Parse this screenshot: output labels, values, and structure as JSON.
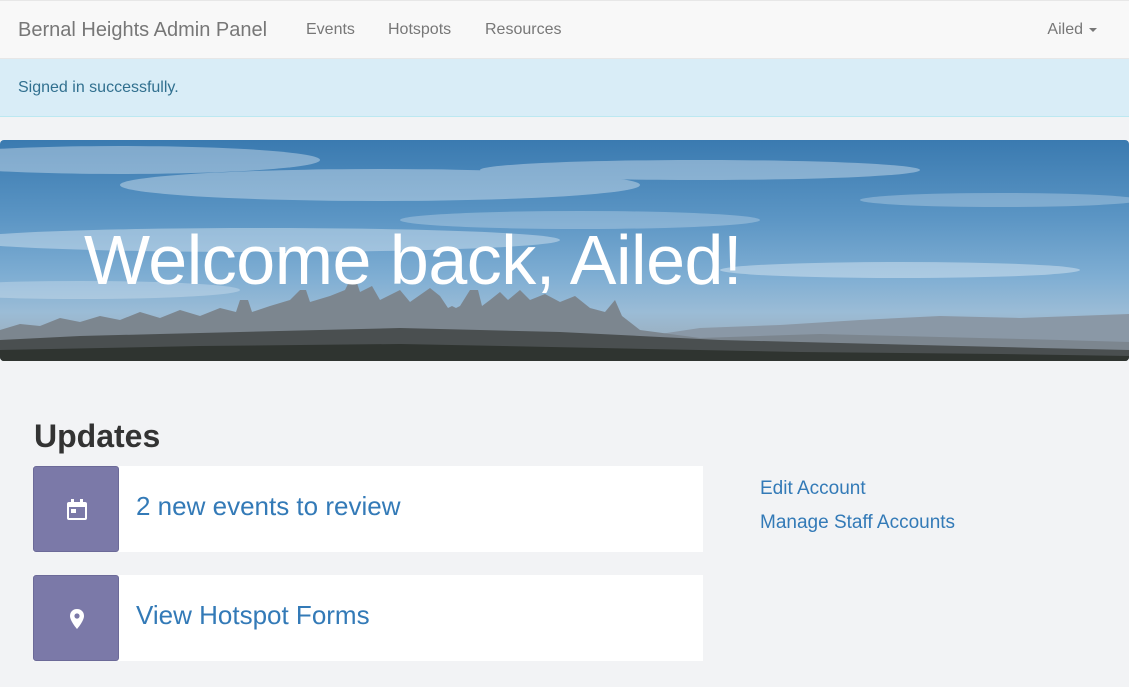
{
  "navbar": {
    "brand": "Bernal Heights Admin Panel",
    "links": [
      {
        "label": "Events"
      },
      {
        "label": "Hotspots"
      },
      {
        "label": "Resources"
      }
    ],
    "user_menu": "Ailed"
  },
  "alert": {
    "message": "Signed in successfully."
  },
  "hero": {
    "title": "Welcome back, Ailed!"
  },
  "updates": {
    "title": "Updates",
    "cards": [
      {
        "label": "2 new events to review",
        "icon": "calendar-icon"
      },
      {
        "label": "View Hotspot Forms",
        "icon": "map-pin-icon"
      }
    ]
  },
  "sidebar": {
    "links": [
      {
        "label": "Edit Account"
      },
      {
        "label": "Manage Staff Accounts"
      }
    ]
  },
  "colors": {
    "navbar_bg": "#f8f8f8",
    "alert_bg": "#d9edf7",
    "alert_text": "#31708f",
    "icon_box": "#7b79a8",
    "link": "#337ab7"
  }
}
